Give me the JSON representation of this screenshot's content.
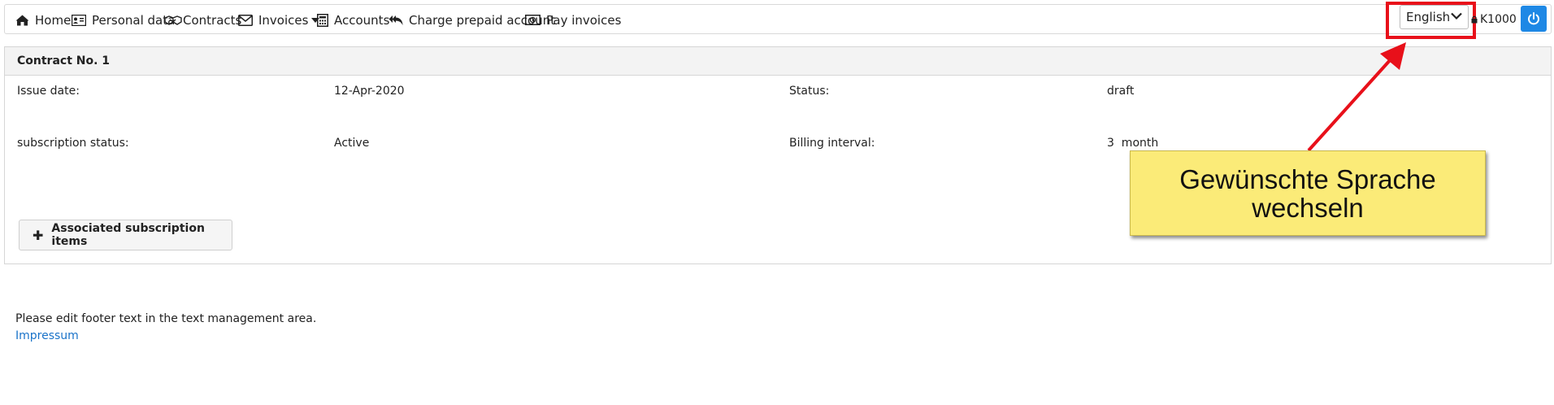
{
  "nav": {
    "home": "Home",
    "personal_data": "Personal data",
    "contracts": "Contracts",
    "invoices": "Invoices",
    "accounts": "Accounts",
    "charge_prepaid": "Charge prepaid account",
    "pay_invoices": "Pay invoices"
  },
  "language": {
    "selected": "English"
  },
  "user": {
    "id": "K1000"
  },
  "contract": {
    "title": "Contract No. 1",
    "issue_date_label": "Issue date:",
    "issue_date_value": "12-Apr-2020",
    "status_label": "Status:",
    "status_value": "draft",
    "subscription_status_label": "subscription status:",
    "subscription_status_value": "Active",
    "billing_interval_label": "Billing interval:",
    "billing_interval_value": "3  month",
    "associated_button": "Associated subscription items"
  },
  "footer": {
    "text": "Please edit footer text in the text management area.",
    "link": "Impressum"
  },
  "annotation": {
    "callout_text": "Gewünschte Sprache\nwechseln",
    "highlight_color": "#e8101a",
    "callout_color": "#fbeb78"
  },
  "colors": {
    "accent": "#1e88e5",
    "link": "#1a73c9"
  }
}
